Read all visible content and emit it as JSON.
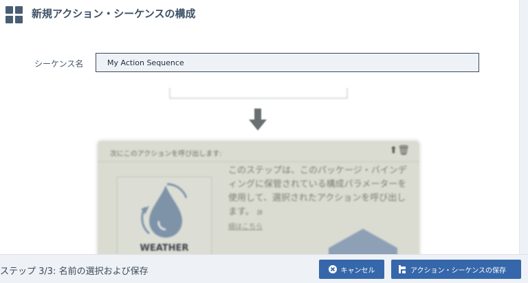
{
  "header": {
    "title": "新規アクション・シーケンスの構成",
    "logo_icon": "grid-icon"
  },
  "form": {
    "sequence_label": "シーケンス名",
    "sequence_value": "My Action Sequence"
  },
  "preview": {
    "heading": "次にこのアクションを呼び出します:",
    "action_icons": [
      "arrow-up-icon",
      "trash-icon"
    ],
    "package_name": "WEATHER",
    "description": "このステップは、このパッケージ・バインディングに保管されている構成パラメーターを使用して、選択されたアクションを呼び出します。",
    "description_small": "詳",
    "detail_link": "細はこちら"
  },
  "footer": {
    "step_text": "ステップ 3/3: 名前の選択および保存",
    "cancel_label": "キャンセル",
    "save_label": "アクション・シーケンスの保存"
  },
  "colors": {
    "accent": "#3567aa",
    "input_border": "#39495b",
    "preview_bg": "#dadcd2"
  }
}
